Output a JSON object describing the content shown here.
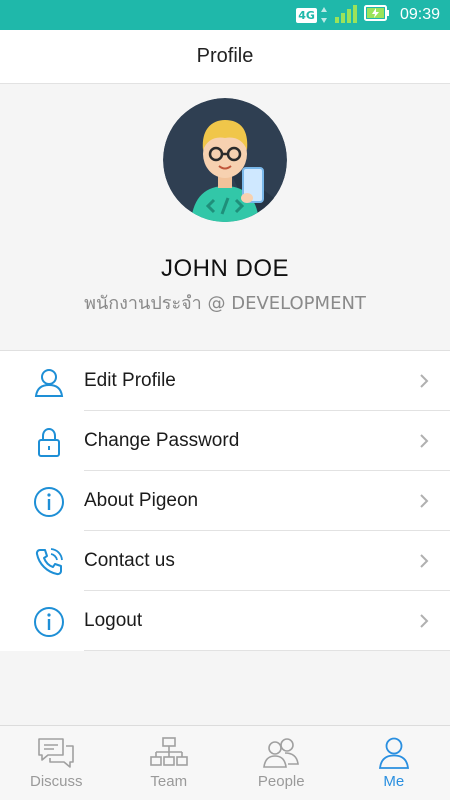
{
  "status_bar": {
    "network": "4G",
    "time": "09:39",
    "icons": [
      "4g-icon",
      "signal-icon",
      "battery-charging-icon"
    ]
  },
  "app_bar": {
    "title": "Profile"
  },
  "profile": {
    "name": "JOHN DOE",
    "role": "พนักงานประจำ @ DEVELOPMENT",
    "avatar_icon": "developer-avatar"
  },
  "menu": {
    "items": [
      {
        "label": "Edit Profile",
        "icon": "user-icon"
      },
      {
        "label": "Change Password",
        "icon": "lock-icon"
      },
      {
        "label": "About Pigeon",
        "icon": "info-icon"
      },
      {
        "label": "Contact us",
        "icon": "phone-icon"
      },
      {
        "label": "Logout",
        "icon": "info-icon"
      }
    ]
  },
  "tab_bar": {
    "active": "Me",
    "tabs": [
      {
        "label": "Discuss",
        "icon": "chat-icon"
      },
      {
        "label": "Team",
        "icon": "org-chart-icon"
      },
      {
        "label": "People",
        "icon": "people-icon"
      },
      {
        "label": "Me",
        "icon": "user-icon"
      }
    ]
  },
  "colors": {
    "status_bar": "#1fb8aa",
    "accent": "#2a8fe0",
    "icon_blue": "#1e8fd6",
    "inactive": "#9a9a9a"
  }
}
